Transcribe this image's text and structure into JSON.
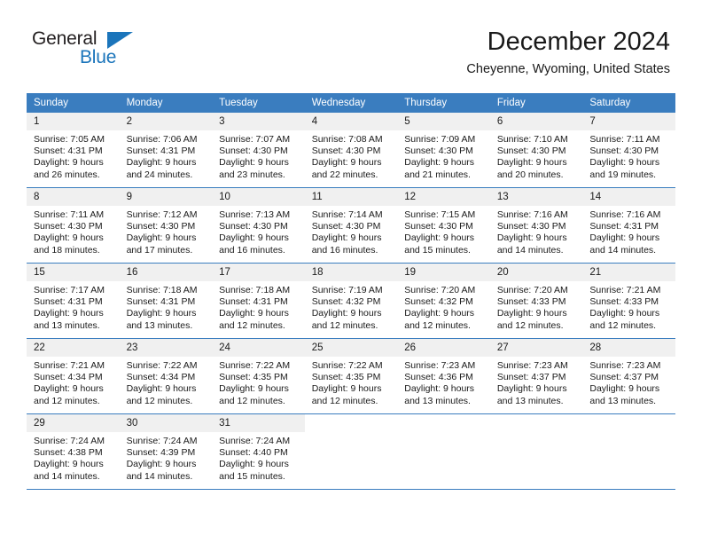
{
  "brand": {
    "name_top": "General",
    "name_bottom": "Blue",
    "triangle_color": "#1b75bb",
    "text_color": "#231f20"
  },
  "header": {
    "month_title": "December 2024",
    "location": "Cheyenne, Wyoming, United States",
    "header_bg": "#3a7dbf",
    "header_text_color": "#ffffff",
    "daynum_bg": "#f0f0f0"
  },
  "weekdays": [
    "Sunday",
    "Monday",
    "Tuesday",
    "Wednesday",
    "Thursday",
    "Friday",
    "Saturday"
  ],
  "weeks": [
    [
      {
        "day": "1",
        "sunrise": "Sunrise: 7:05 AM",
        "sunset": "Sunset: 4:31 PM",
        "daylight1": "Daylight: 9 hours",
        "daylight2": "and 26 minutes."
      },
      {
        "day": "2",
        "sunrise": "Sunrise: 7:06 AM",
        "sunset": "Sunset: 4:31 PM",
        "daylight1": "Daylight: 9 hours",
        "daylight2": "and 24 minutes."
      },
      {
        "day": "3",
        "sunrise": "Sunrise: 7:07 AM",
        "sunset": "Sunset: 4:30 PM",
        "daylight1": "Daylight: 9 hours",
        "daylight2": "and 23 minutes."
      },
      {
        "day": "4",
        "sunrise": "Sunrise: 7:08 AM",
        "sunset": "Sunset: 4:30 PM",
        "daylight1": "Daylight: 9 hours",
        "daylight2": "and 22 minutes."
      },
      {
        "day": "5",
        "sunrise": "Sunrise: 7:09 AM",
        "sunset": "Sunset: 4:30 PM",
        "daylight1": "Daylight: 9 hours",
        "daylight2": "and 21 minutes."
      },
      {
        "day": "6",
        "sunrise": "Sunrise: 7:10 AM",
        "sunset": "Sunset: 4:30 PM",
        "daylight1": "Daylight: 9 hours",
        "daylight2": "and 20 minutes."
      },
      {
        "day": "7",
        "sunrise": "Sunrise: 7:11 AM",
        "sunset": "Sunset: 4:30 PM",
        "daylight1": "Daylight: 9 hours",
        "daylight2": "and 19 minutes."
      }
    ],
    [
      {
        "day": "8",
        "sunrise": "Sunrise: 7:11 AM",
        "sunset": "Sunset: 4:30 PM",
        "daylight1": "Daylight: 9 hours",
        "daylight2": "and 18 minutes."
      },
      {
        "day": "9",
        "sunrise": "Sunrise: 7:12 AM",
        "sunset": "Sunset: 4:30 PM",
        "daylight1": "Daylight: 9 hours",
        "daylight2": "and 17 minutes."
      },
      {
        "day": "10",
        "sunrise": "Sunrise: 7:13 AM",
        "sunset": "Sunset: 4:30 PM",
        "daylight1": "Daylight: 9 hours",
        "daylight2": "and 16 minutes."
      },
      {
        "day": "11",
        "sunrise": "Sunrise: 7:14 AM",
        "sunset": "Sunset: 4:30 PM",
        "daylight1": "Daylight: 9 hours",
        "daylight2": "and 16 minutes."
      },
      {
        "day": "12",
        "sunrise": "Sunrise: 7:15 AM",
        "sunset": "Sunset: 4:30 PM",
        "daylight1": "Daylight: 9 hours",
        "daylight2": "and 15 minutes."
      },
      {
        "day": "13",
        "sunrise": "Sunrise: 7:16 AM",
        "sunset": "Sunset: 4:30 PM",
        "daylight1": "Daylight: 9 hours",
        "daylight2": "and 14 minutes."
      },
      {
        "day": "14",
        "sunrise": "Sunrise: 7:16 AM",
        "sunset": "Sunset: 4:31 PM",
        "daylight1": "Daylight: 9 hours",
        "daylight2": "and 14 minutes."
      }
    ],
    [
      {
        "day": "15",
        "sunrise": "Sunrise: 7:17 AM",
        "sunset": "Sunset: 4:31 PM",
        "daylight1": "Daylight: 9 hours",
        "daylight2": "and 13 minutes."
      },
      {
        "day": "16",
        "sunrise": "Sunrise: 7:18 AM",
        "sunset": "Sunset: 4:31 PM",
        "daylight1": "Daylight: 9 hours",
        "daylight2": "and 13 minutes."
      },
      {
        "day": "17",
        "sunrise": "Sunrise: 7:18 AM",
        "sunset": "Sunset: 4:31 PM",
        "daylight1": "Daylight: 9 hours",
        "daylight2": "and 12 minutes."
      },
      {
        "day": "18",
        "sunrise": "Sunrise: 7:19 AM",
        "sunset": "Sunset: 4:32 PM",
        "daylight1": "Daylight: 9 hours",
        "daylight2": "and 12 minutes."
      },
      {
        "day": "19",
        "sunrise": "Sunrise: 7:20 AM",
        "sunset": "Sunset: 4:32 PM",
        "daylight1": "Daylight: 9 hours",
        "daylight2": "and 12 minutes."
      },
      {
        "day": "20",
        "sunrise": "Sunrise: 7:20 AM",
        "sunset": "Sunset: 4:33 PM",
        "daylight1": "Daylight: 9 hours",
        "daylight2": "and 12 minutes."
      },
      {
        "day": "21",
        "sunrise": "Sunrise: 7:21 AM",
        "sunset": "Sunset: 4:33 PM",
        "daylight1": "Daylight: 9 hours",
        "daylight2": "and 12 minutes."
      }
    ],
    [
      {
        "day": "22",
        "sunrise": "Sunrise: 7:21 AM",
        "sunset": "Sunset: 4:34 PM",
        "daylight1": "Daylight: 9 hours",
        "daylight2": "and 12 minutes."
      },
      {
        "day": "23",
        "sunrise": "Sunrise: 7:22 AM",
        "sunset": "Sunset: 4:34 PM",
        "daylight1": "Daylight: 9 hours",
        "daylight2": "and 12 minutes."
      },
      {
        "day": "24",
        "sunrise": "Sunrise: 7:22 AM",
        "sunset": "Sunset: 4:35 PM",
        "daylight1": "Daylight: 9 hours",
        "daylight2": "and 12 minutes."
      },
      {
        "day": "25",
        "sunrise": "Sunrise: 7:22 AM",
        "sunset": "Sunset: 4:35 PM",
        "daylight1": "Daylight: 9 hours",
        "daylight2": "and 12 minutes."
      },
      {
        "day": "26",
        "sunrise": "Sunrise: 7:23 AM",
        "sunset": "Sunset: 4:36 PM",
        "daylight1": "Daylight: 9 hours",
        "daylight2": "and 13 minutes."
      },
      {
        "day": "27",
        "sunrise": "Sunrise: 7:23 AM",
        "sunset": "Sunset: 4:37 PM",
        "daylight1": "Daylight: 9 hours",
        "daylight2": "and 13 minutes."
      },
      {
        "day": "28",
        "sunrise": "Sunrise: 7:23 AM",
        "sunset": "Sunset: 4:37 PM",
        "daylight1": "Daylight: 9 hours",
        "daylight2": "and 13 minutes."
      }
    ],
    [
      {
        "day": "29",
        "sunrise": "Sunrise: 7:24 AM",
        "sunset": "Sunset: 4:38 PM",
        "daylight1": "Daylight: 9 hours",
        "daylight2": "and 14 minutes."
      },
      {
        "day": "30",
        "sunrise": "Sunrise: 7:24 AM",
        "sunset": "Sunset: 4:39 PM",
        "daylight1": "Daylight: 9 hours",
        "daylight2": "and 14 minutes."
      },
      {
        "day": "31",
        "sunrise": "Sunrise: 7:24 AM",
        "sunset": "Sunset: 4:40 PM",
        "daylight1": "Daylight: 9 hours",
        "daylight2": "and 15 minutes."
      },
      {
        "day": "",
        "sunrise": "",
        "sunset": "",
        "daylight1": "",
        "daylight2": ""
      },
      {
        "day": "",
        "sunrise": "",
        "sunset": "",
        "daylight1": "",
        "daylight2": ""
      },
      {
        "day": "",
        "sunrise": "",
        "sunset": "",
        "daylight1": "",
        "daylight2": ""
      },
      {
        "day": "",
        "sunrise": "",
        "sunset": "",
        "daylight1": "",
        "daylight2": ""
      }
    ]
  ]
}
